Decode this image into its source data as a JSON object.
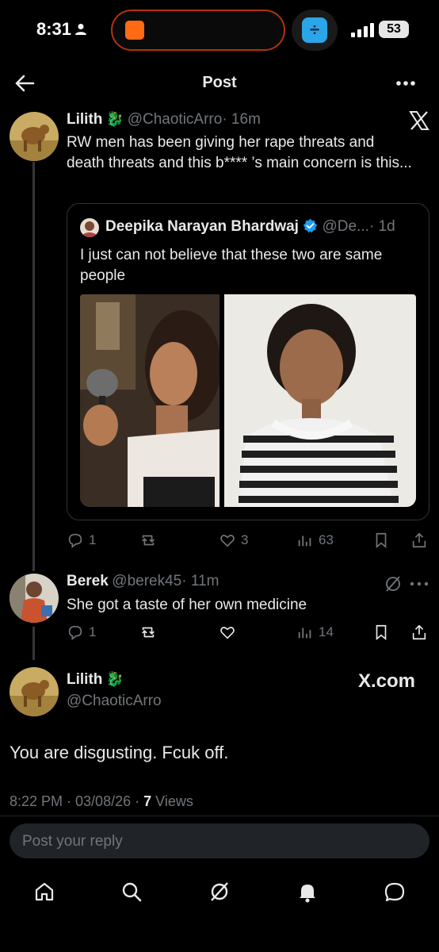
{
  "status_bar": {
    "time": "8:31",
    "battery": "53",
    "island_app_icon": "app-icon",
    "island2_symbol": "÷"
  },
  "header": {
    "title": "Post",
    "back_icon": "back-arrow-icon",
    "more_icon": "more-icon"
  },
  "main_post": {
    "author_name": "Lilith",
    "author_emoji": "🐉",
    "author_handle": "@ChaoticArro",
    "age": "· 16m",
    "text": "RW men has been giving her rape threats and death threats and this b**** ’s main concern is this...",
    "quote": {
      "author_name": "Deepika Narayan Bhardwaj",
      "verified": true,
      "author_handle": "@De...",
      "age": "· 1d",
      "text": "I just can not believe that these two are same people"
    },
    "stats": {
      "replies": "1",
      "reposts": "",
      "likes": "3",
      "views": "63"
    }
  },
  "reply_post": {
    "author_name": "Berek",
    "author_handle": "@berek45",
    "age": "· 11m",
    "text": "She got a taste of her own medicine",
    "stats": {
      "replies": "1",
      "reposts": "",
      "likes": "",
      "views": "14"
    }
  },
  "focused_post": {
    "author_name": "Lilith",
    "author_emoji": "🐉",
    "author_handle": "@ChaoticArro",
    "watermark": "X.com",
    "text": "You are disgusting. Fcuk off.",
    "timestamp": "8:22 PM · 03/08/26 ·",
    "views_count": "7",
    "views_label": "Views"
  },
  "reply_input": {
    "placeholder": "Post your reply"
  },
  "tabbar": {
    "items": [
      "home-icon",
      "search-icon",
      "grok-icon",
      "notifications-icon",
      "messages-icon"
    ]
  },
  "colors": {
    "background": "#000000",
    "text": "#e7e9ea",
    "muted": "#71767b",
    "verified": "#1d9bf0",
    "border": "#2f3336",
    "island_border": "#b2320d"
  }
}
